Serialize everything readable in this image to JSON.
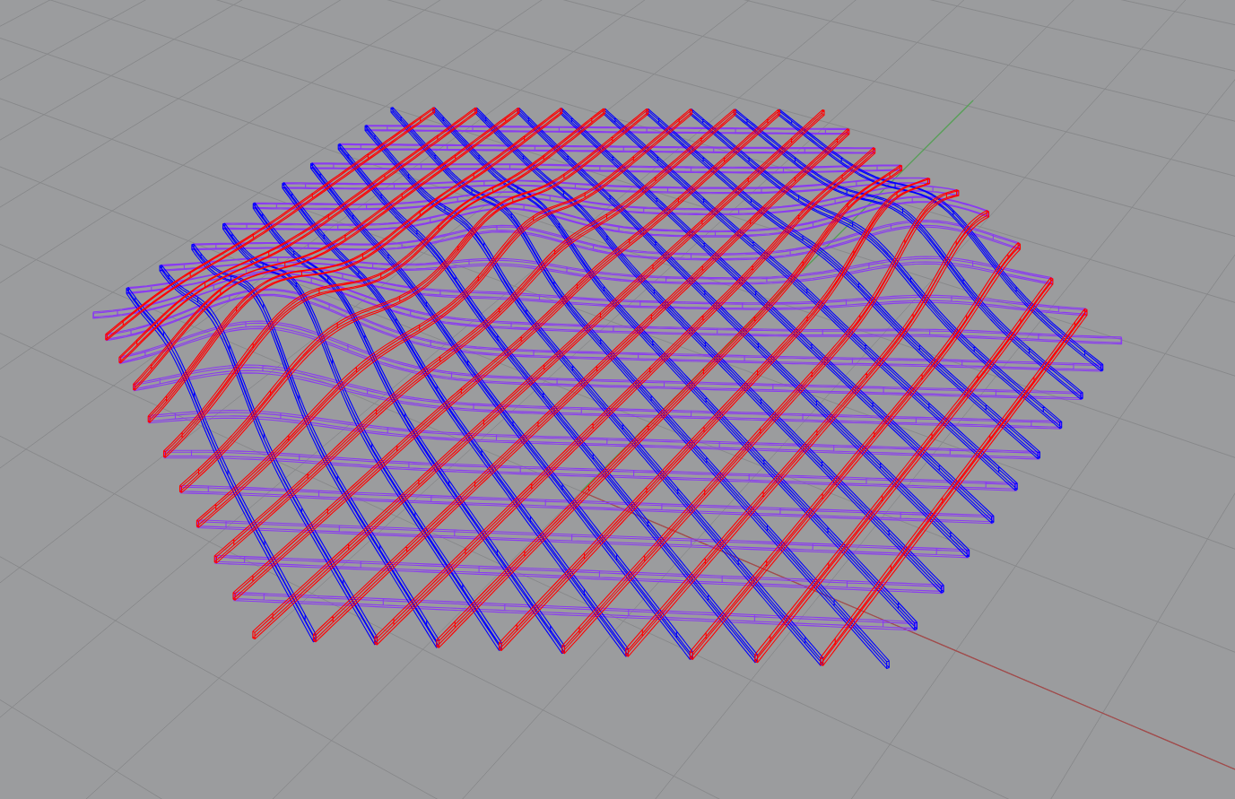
{
  "viewport": {
    "axes": [
      {
        "color": "#a34a4a"
      },
      {
        "color": "#55a055"
      }
    ],
    "beam_families": [
      {
        "color": "#8a3cf0"
      },
      {
        "color": "#0000ff"
      },
      {
        "color": "#ff0000"
      }
    ]
  }
}
